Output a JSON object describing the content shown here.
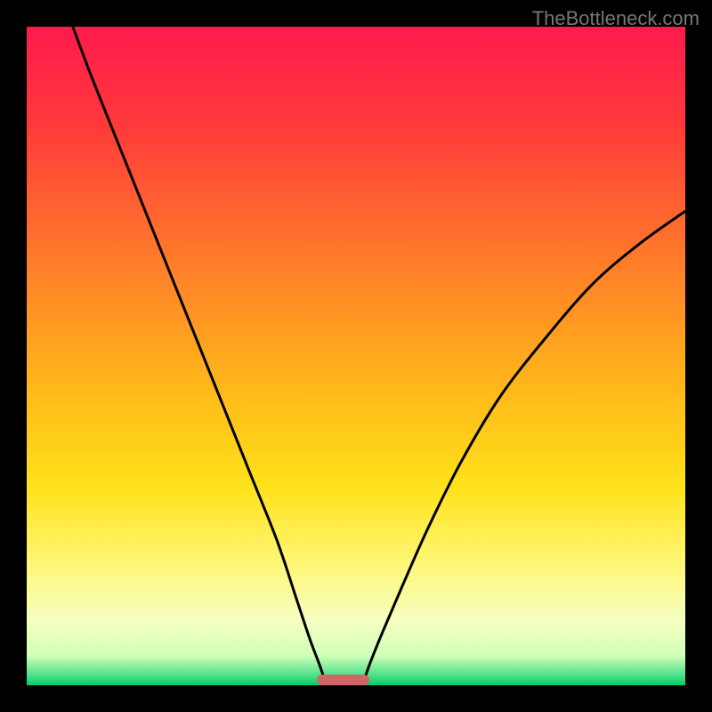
{
  "watermark": "TheBottleneck.com",
  "chart_data": {
    "type": "line",
    "title": "",
    "xlabel": "",
    "ylabel": "",
    "xlim": [
      0,
      100
    ],
    "ylim": [
      0,
      100
    ],
    "gradient_stops": [
      {
        "pos": 0.0,
        "color": "#ff1a4d"
      },
      {
        "pos": 0.15,
        "color": "#ff3a3a"
      },
      {
        "pos": 0.35,
        "color": "#ff7a2a"
      },
      {
        "pos": 0.55,
        "color": "#ffb81a"
      },
      {
        "pos": 0.7,
        "color": "#ffe21a"
      },
      {
        "pos": 0.82,
        "color": "#fff77a"
      },
      {
        "pos": 0.9,
        "color": "#f5ffc0"
      },
      {
        "pos": 0.955,
        "color": "#d2ffb8"
      },
      {
        "pos": 0.985,
        "color": "#4de08a"
      },
      {
        "pos": 1.0,
        "color": "#00cc66"
      }
    ],
    "series": [
      {
        "name": "left-curve",
        "x": [
          7,
          10,
          14,
          18,
          22,
          26,
          30,
          34,
          38,
          41,
          43,
          44.5,
          45.5
        ],
        "y": [
          100,
          92,
          82,
          72,
          62,
          52,
          42,
          32,
          22,
          13,
          7,
          3,
          0
        ]
      },
      {
        "name": "right-curve",
        "x": [
          51,
          52,
          54,
          57,
          61,
          66,
          72,
          79,
          86,
          93,
          100
        ],
        "y": [
          0,
          3,
          8,
          15,
          24,
          34,
          44,
          53,
          61,
          67,
          72
        ]
      }
    ],
    "flat_marker": {
      "x_start": 44,
      "x_end": 52,
      "y": 0
    }
  }
}
